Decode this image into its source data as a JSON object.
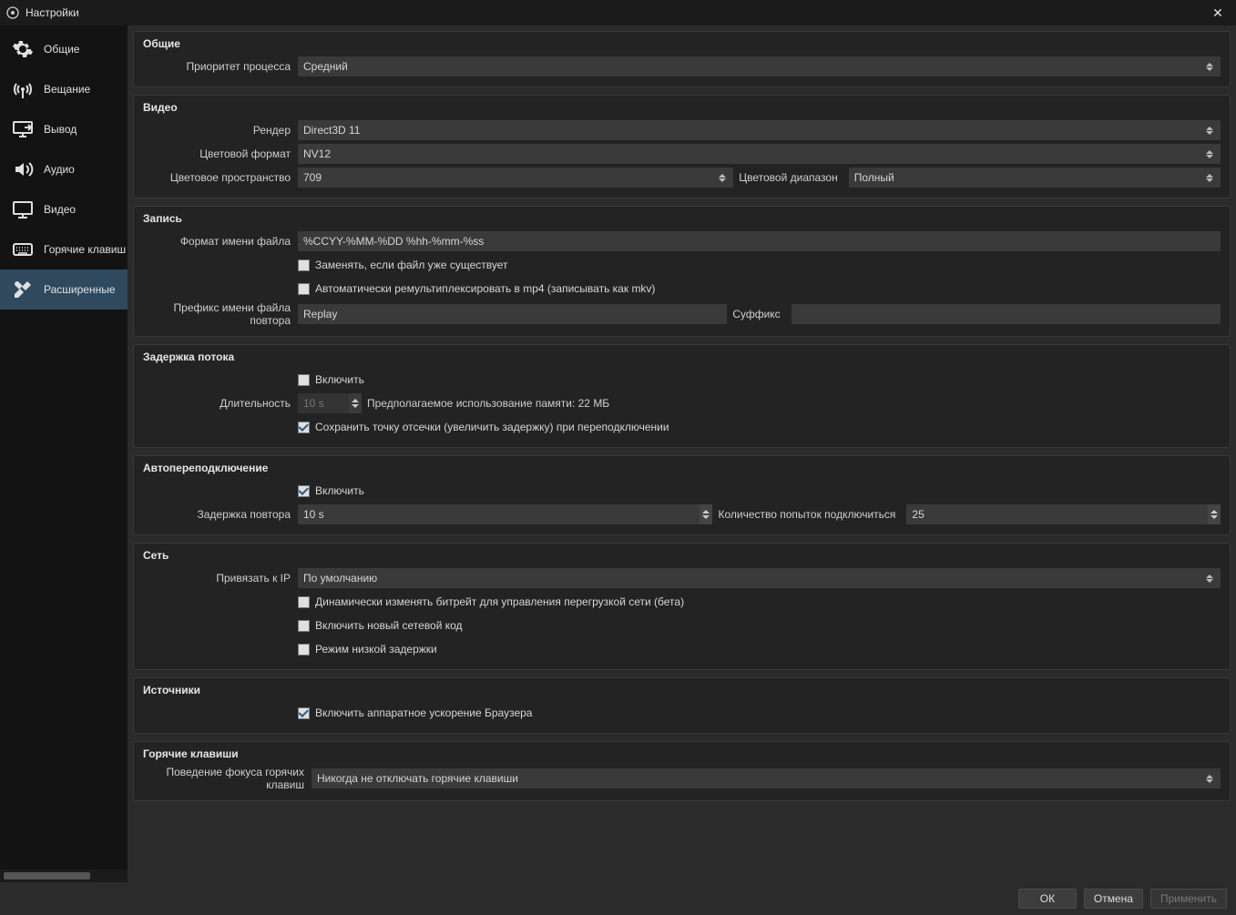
{
  "window": {
    "title": "Настройки"
  },
  "sidebar": [
    {
      "id": "general",
      "label": "Общие",
      "active": false
    },
    {
      "id": "stream",
      "label": "Вещание",
      "active": false
    },
    {
      "id": "output",
      "label": "Вывод",
      "active": false
    },
    {
      "id": "audio",
      "label": "Аудио",
      "active": false
    },
    {
      "id": "video",
      "label": "Видео",
      "active": false
    },
    {
      "id": "hotkeys",
      "label": "Горячие клавиш",
      "active": false
    },
    {
      "id": "advanced",
      "label": "Расширенные",
      "active": true
    }
  ],
  "groups": {
    "general": {
      "title": "Общие",
      "priority_label": "Приоритет процесса",
      "priority_value": "Средний"
    },
    "video": {
      "title": "Видео",
      "renderer_label": "Рендер",
      "renderer_value": "Direct3D 11",
      "color_format_label": "Цветовой формат",
      "color_format_value": "NV12",
      "color_space_label": "Цветовое пространство",
      "color_space_value": "709",
      "color_range_label": "Цветовой диапазон",
      "color_range_value": "Полный"
    },
    "recording": {
      "title": "Запись",
      "filename_format_label": "Формат имени файла",
      "filename_format_value": "%CCYY-%MM-%DD %hh-%mm-%ss",
      "overwrite_label": "Заменять, если файл уже существует",
      "overwrite_checked": false,
      "remux_label": "Автоматически ремультиплексировать в mp4 (записывать как mkv)",
      "remux_checked": false,
      "replay_prefix_label": "Префикс имени файла повтора",
      "replay_prefix_value": "Replay",
      "replay_suffix_label": "Суффикс",
      "replay_suffix_value": ""
    },
    "stream_delay": {
      "title": "Задержка потока",
      "enable_label": "Включить",
      "enable_checked": false,
      "duration_label": "Длительность",
      "duration_value": "10 s",
      "memory_hint": "Предполагаемое использование памяти: 22 МБ",
      "preserve_label": "Сохранить точку отсечки (увеличить задержку) при переподключении",
      "preserve_checked": true
    },
    "reconnect": {
      "title": "Автопереподключение",
      "enable_label": "Включить",
      "enable_checked": true,
      "retry_delay_label": "Задержка повтора",
      "retry_delay_value": "10 s",
      "max_retries_label": "Количество попыток подключиться",
      "max_retries_value": "25"
    },
    "network": {
      "title": "Сеть",
      "bind_ip_label": "Привязать к IP",
      "bind_ip_value": "По умолчанию",
      "dyn_bitrate_label": "Динамически изменять битрейт для управления перегрузкой сети (бета)",
      "dyn_bitrate_checked": false,
      "new_net_label": "Включить новый сетевой код",
      "new_net_checked": false,
      "low_latency_label": "Режим низкой задержки",
      "low_latency_checked": false
    },
    "sources": {
      "title": "Источники",
      "browser_hw_label": "Включить аппаратное ускорение Браузера",
      "browser_hw_checked": true
    },
    "hotkeys": {
      "title": "Горячие клавиши",
      "focus_label": "Поведение фокуса горячих клавиш",
      "focus_value": "Никогда не отключать горячие клавиши"
    }
  },
  "footer": {
    "ok": "ОК",
    "cancel": "Отмена",
    "apply": "Применить"
  }
}
